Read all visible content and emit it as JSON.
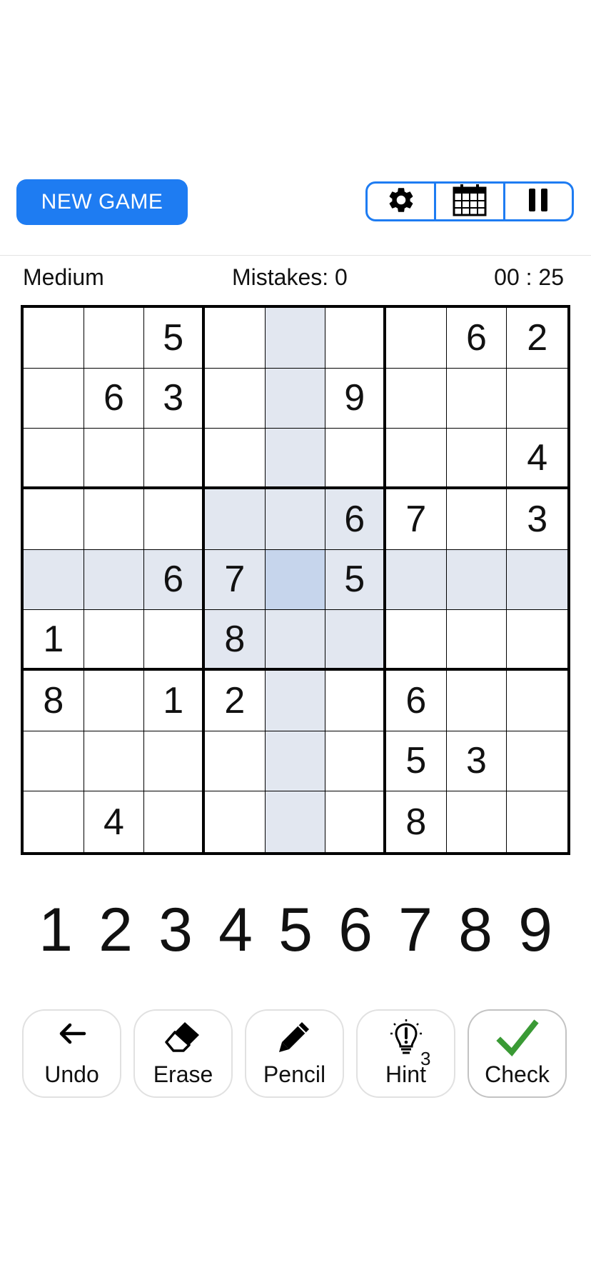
{
  "header": {
    "new_game_label": "NEW GAME",
    "icons": [
      "gear-icon",
      "calendar-icon",
      "pause-icon"
    ]
  },
  "status": {
    "difficulty": "Medium",
    "mistakes": "Mistakes: 0",
    "timer": "00 : 25"
  },
  "board": {
    "grid": [
      [
        "",
        "",
        "5",
        "",
        "",
        "",
        "",
        "6",
        "2"
      ],
      [
        "",
        "6",
        "3",
        "",
        "",
        "9",
        "",
        "",
        ""
      ],
      [
        "",
        "",
        "",
        "",
        "",
        "",
        "",
        "",
        "4"
      ],
      [
        "",
        "",
        "",
        "",
        "",
        "6",
        "7",
        "",
        "3"
      ],
      [
        "",
        "",
        "6",
        "7",
        "",
        "5",
        "",
        "",
        ""
      ],
      [
        "1",
        "",
        "",
        "8",
        "",
        "",
        "",
        "",
        ""
      ],
      [
        "8",
        "",
        "1",
        "2",
        "",
        "",
        "6",
        "",
        ""
      ],
      [
        "",
        "",
        "",
        "",
        "",
        "",
        "5",
        "3",
        ""
      ],
      [
        "",
        "4",
        "",
        "",
        "",
        "",
        "8",
        "",
        ""
      ]
    ],
    "selected_cell": {
      "row": 5,
      "col": 5
    },
    "highlight_color": "#e2e7f0",
    "selected_color": "#c6d5ec"
  },
  "numpad": [
    "1",
    "2",
    "3",
    "4",
    "5",
    "6",
    "7",
    "8",
    "9"
  ],
  "tools": {
    "undo": {
      "label": "Undo",
      "icon": "arrow-left-icon"
    },
    "erase": {
      "label": "Erase",
      "icon": "eraser-icon"
    },
    "pencil": {
      "label": "Pencil",
      "icon": "pencil-icon"
    },
    "hint": {
      "label": "Hint",
      "icon": "lightbulb-icon",
      "count": "3"
    },
    "check": {
      "label": "Check",
      "icon": "checkmark-icon"
    }
  },
  "colors": {
    "accent": "#1e7cf2",
    "check_green": "#3a9a35"
  }
}
